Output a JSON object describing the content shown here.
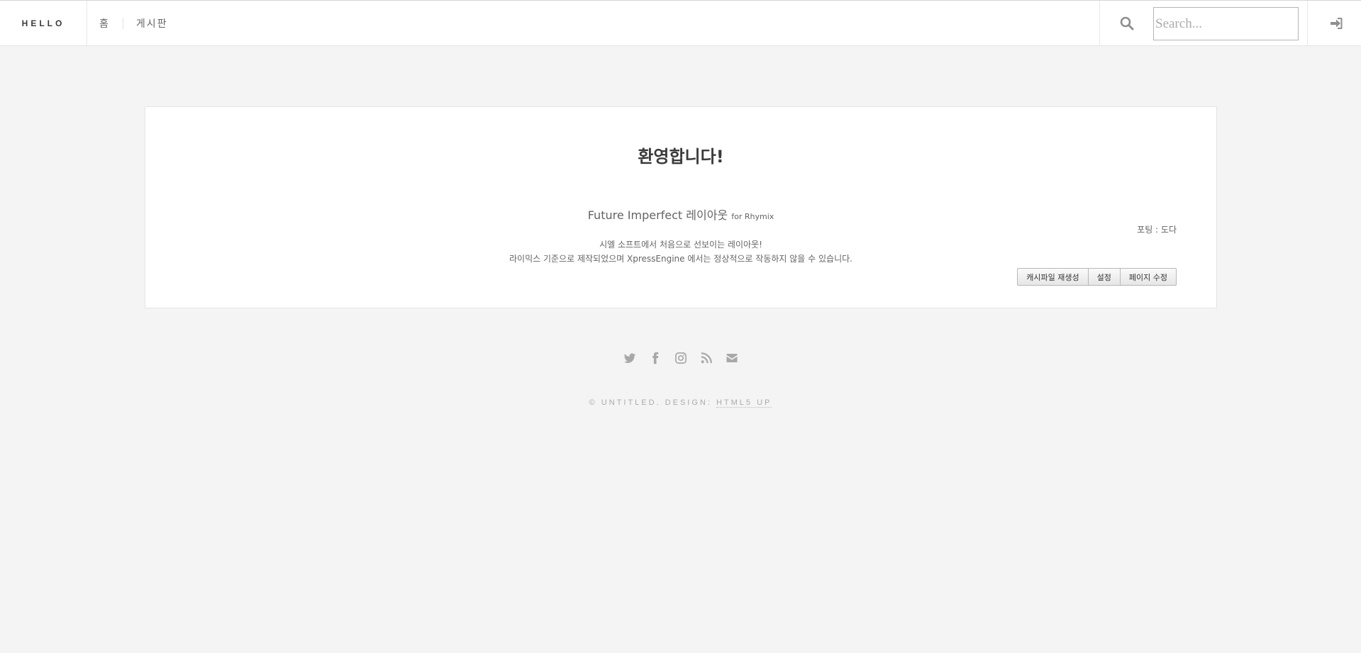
{
  "header": {
    "logo": "HELLO",
    "nav": [
      {
        "label": "홈"
      },
      {
        "label": "게시판"
      }
    ],
    "search": {
      "placeholder": "Search..."
    }
  },
  "main": {
    "welcome": "환영합니다!",
    "subtitle_main": "Future Imperfect 레이아웃",
    "subtitle_small": "for Rhymix",
    "desc_line1": "시엘 소프트에서 처음으로 선보이는 레이아웃!",
    "desc_line2": "라이믹스 기준으로 제작되었으며 XpressEngine 에서는 정상적으로 작동하지 않을 수 있습니다.",
    "porting": "포팅 : 도다",
    "buttons": {
      "cache": "캐시파일 재생성",
      "settings": "설정",
      "edit_page": "페이지 수정"
    }
  },
  "footer": {
    "social_icons": [
      "twitter-icon",
      "facebook-icon",
      "instagram-icon",
      "rss-icon",
      "envelope-icon"
    ],
    "copyright_prefix": "© UNTITLED. DESIGN: ",
    "copyright_link": "HTML5 UP"
  },
  "colors": {
    "background": "#f4f4f4",
    "panel": "#ffffff",
    "text": "#3c3b3b",
    "muted": "#aaaaaa"
  }
}
